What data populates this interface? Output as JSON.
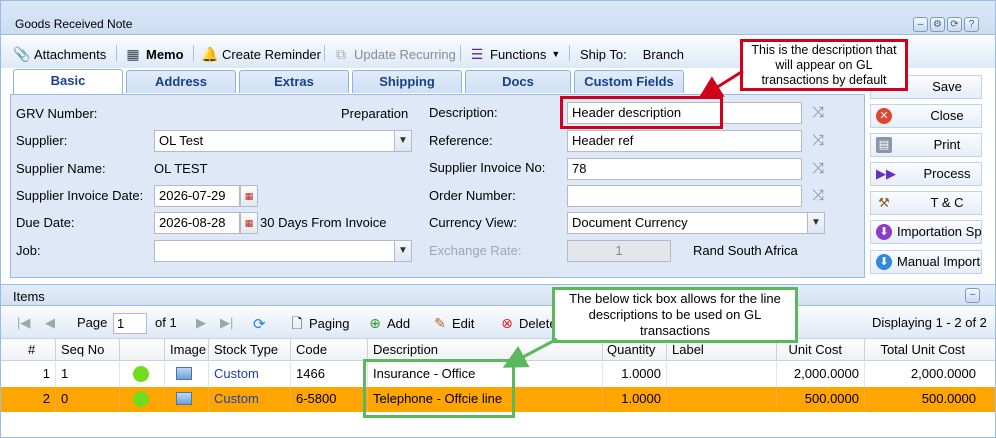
{
  "window": {
    "title": "Goods Received Note"
  },
  "toolbar": {
    "attachments": "Attachments",
    "memo": "Memo",
    "create_reminder": "Create Reminder",
    "update_recurring": "Update Recurring",
    "functions": "Functions",
    "ship_to_label": "Ship To:",
    "ship_to_value": "Branch"
  },
  "tabs": [
    "Basic",
    "Address",
    "Extras",
    "Shipping",
    "Docs",
    "Custom Fields"
  ],
  "form": {
    "grv_number_label": "GRV Number:",
    "grv_status": "Preparation",
    "supplier_label": "Supplier:",
    "supplier_value": "OL Test",
    "supplier_name_label": "Supplier Name:",
    "supplier_name_value": "OL TEST",
    "supplier_invoice_date_label": "Supplier Invoice Date:",
    "supplier_invoice_date_value": "2026-07-29",
    "due_date_label": "Due Date:",
    "due_date_value": "2026-08-28",
    "due_date_terms": "30 Days From Invoice",
    "job_label": "Job:",
    "job_value": "",
    "description_label": "Description:",
    "description_value": "Header description",
    "reference_label": "Reference:",
    "reference_value": "Header ref",
    "supplier_invoice_no_label": "Supplier Invoice No:",
    "supplier_invoice_no_value": "78",
    "order_number_label": "Order Number:",
    "order_number_value": "",
    "currency_view_label": "Currency View:",
    "currency_view_value": "Document Currency",
    "exchange_rate_label": "Exchange Rate:",
    "exchange_rate_value": "1",
    "currency_name": "Rand South Africa"
  },
  "side_buttons": {
    "save": "Save",
    "close": "Close",
    "print": "Print",
    "process": "Process",
    "tc": "T & C",
    "importation": "Importation Spl",
    "manual_import": "Manual Importa"
  },
  "items": {
    "title": "Items",
    "page_label": "Page",
    "page_value": "1",
    "of_label": "of 1",
    "paging": "Paging",
    "add": "Add",
    "edit": "Edit",
    "delete": "Delete",
    "displaying": "Displaying 1 - 2 of 2",
    "columns": [
      "#",
      "Seq No",
      "",
      "Image",
      "Stock Type",
      "Code",
      "Description",
      "Quantity",
      "Label",
      "Unit Cost",
      "Total Unit Cost"
    ],
    "rows": [
      {
        "num": "1",
        "seq": "1",
        "stock_type": "Custom",
        "code": "1466",
        "description": "Insurance - Office",
        "quantity": "1.0000",
        "label": "",
        "unit_cost": "2,000.0000",
        "total_unit_cost": "2,000.0000"
      },
      {
        "num": "2",
        "seq": "0",
        "stock_type": "Custom",
        "code": "6-5800",
        "description": "Telephone - Offcie line",
        "quantity": "1.0000",
        "label": "",
        "unit_cost": "500.0000",
        "total_unit_cost": "500.0000"
      }
    ]
  },
  "annotations": {
    "red": "This is the description that will appear on GL transactions by default",
    "green": "The below tick box allows for the line descriptions to be used on GL transactions"
  },
  "colors": {
    "selected_row": "#ffa500",
    "status_dot": "#6fdc1e",
    "callout_red": "#d0021b",
    "callout_green": "#5cb85c"
  }
}
